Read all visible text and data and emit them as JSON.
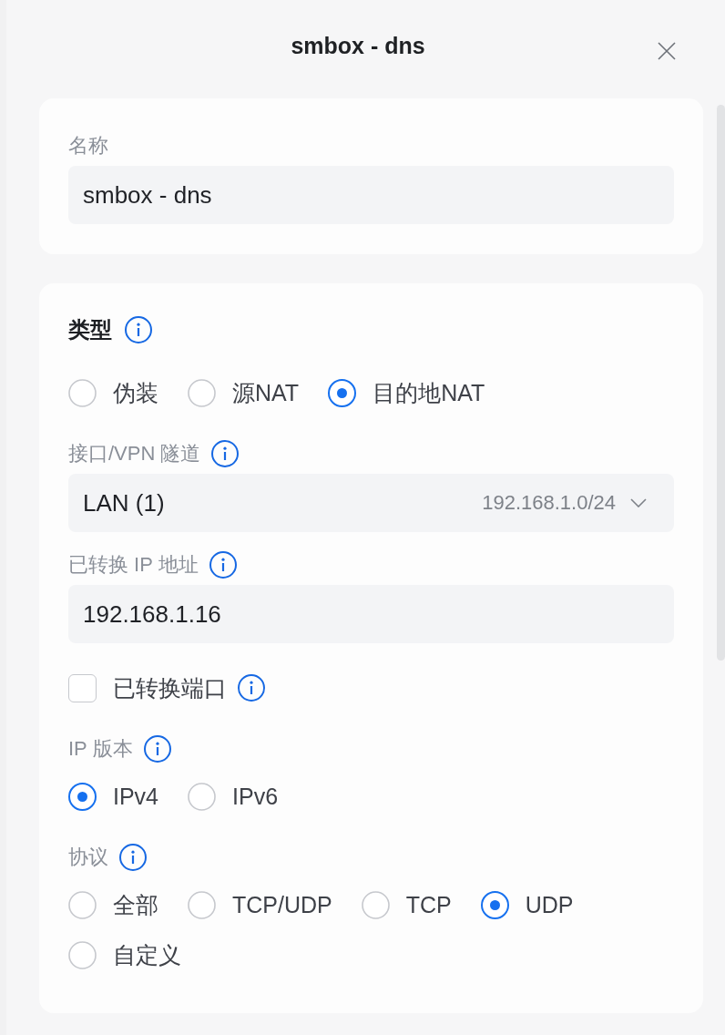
{
  "dialog": {
    "title": "smbox - dns"
  },
  "sections": [
    {
      "fields": [
        {
          "kind": "label",
          "text": "名称",
          "info_icon": false
        },
        {
          "kind": "text_input",
          "value": "smbox - dns"
        }
      ]
    },
    {
      "fields": [
        {
          "kind": "heading",
          "text": "类型",
          "info_icon": true
        },
        {
          "kind": "radio_group",
          "options": [
            {
              "label": "伪装",
              "selected": false
            },
            {
              "label": "源NAT",
              "selected": false
            },
            {
              "label": "目的地NAT",
              "selected": true
            }
          ]
        },
        {
          "kind": "label",
          "text": "接口/VPN 隧道",
          "info_icon": true
        },
        {
          "kind": "select",
          "value": "LAN (1)",
          "detail": "192.168.1.0/24"
        },
        {
          "kind": "label",
          "text": "已转换 IP 地址",
          "info_icon": true
        },
        {
          "kind": "text_input",
          "value": "192.168.1.16"
        },
        {
          "kind": "checkbox",
          "text": "已转换端口",
          "checked": false,
          "info_icon": true
        },
        {
          "kind": "label",
          "text": "IP 版本",
          "info_icon": true
        },
        {
          "kind": "radio_group",
          "options": [
            {
              "label": "IPv4",
              "selected": true
            },
            {
              "label": "IPv6",
              "selected": false
            }
          ]
        },
        {
          "kind": "label",
          "text": "协议",
          "info_icon": true
        },
        {
          "kind": "radio_group",
          "options": [
            {
              "label": "全部",
              "selected": false
            },
            {
              "label": "TCP/UDP",
              "selected": false
            },
            {
              "label": "TCP",
              "selected": false
            },
            {
              "label": "UDP",
              "selected": true
            },
            {
              "label": "自定义",
              "selected": false
            }
          ]
        }
      ]
    }
  ]
}
